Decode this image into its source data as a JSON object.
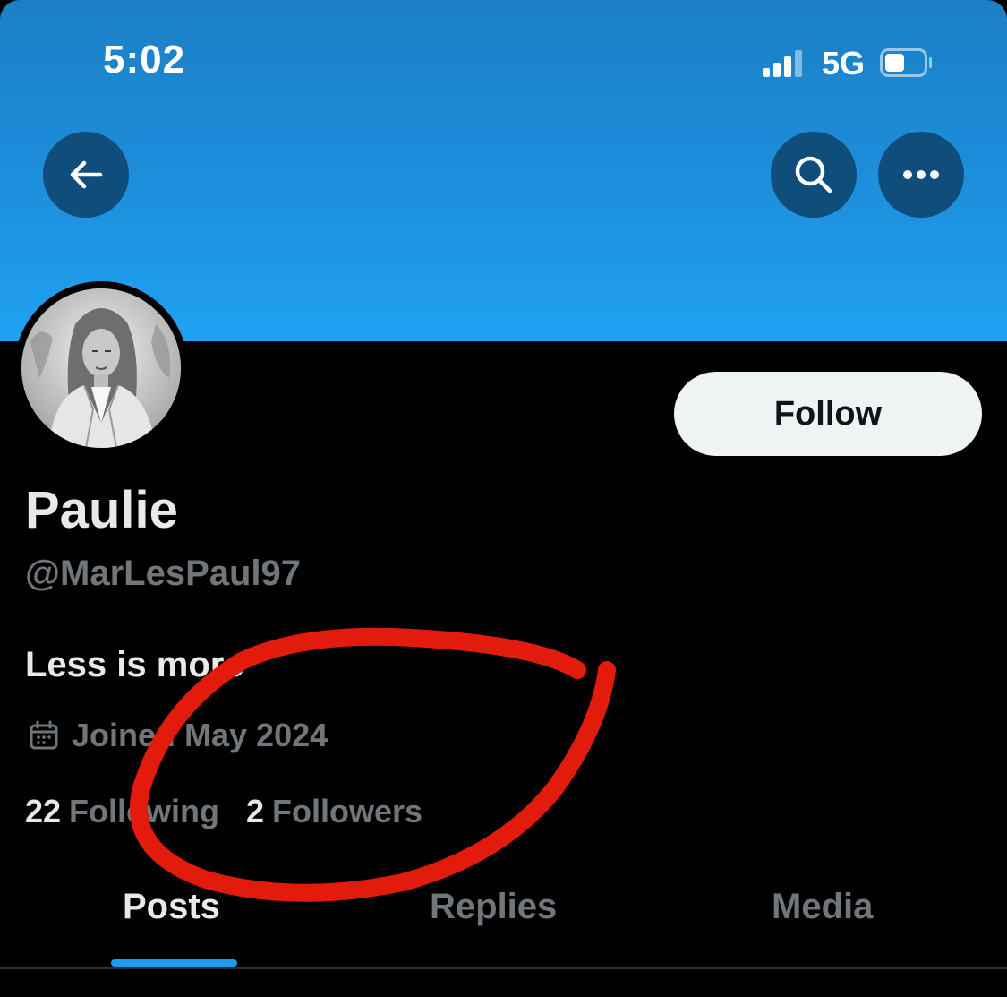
{
  "status_bar": {
    "time": "5:02",
    "network": "5G",
    "signal_icon": "cellular-signal-icon",
    "battery_icon": "battery-icon",
    "battery_level": 0.45
  },
  "header": {
    "back_icon": "arrow-left-icon",
    "search_icon": "search-icon",
    "more_icon": "more-horizontal-icon"
  },
  "profile": {
    "display_name": "Paulie",
    "handle": "@MarLesPaul97",
    "bio": "Less is more",
    "joined": "Joined May 2024",
    "follow_label": "Follow",
    "following_count": "22",
    "following_label": "Following",
    "followers_count": "2",
    "followers_label": "Followers"
  },
  "tabs": [
    {
      "label": "Posts",
      "active": true
    },
    {
      "label": "Replies",
      "active": false
    },
    {
      "label": "Media",
      "active": false
    }
  ],
  "colors": {
    "banner_top": "#1b7fc6",
    "banner_bottom": "#1fa2f2",
    "accent": "#1d9bf0",
    "annotation": "#e31b0c",
    "muted_text": "#71767b",
    "primary_text": "#e7e9ea"
  }
}
